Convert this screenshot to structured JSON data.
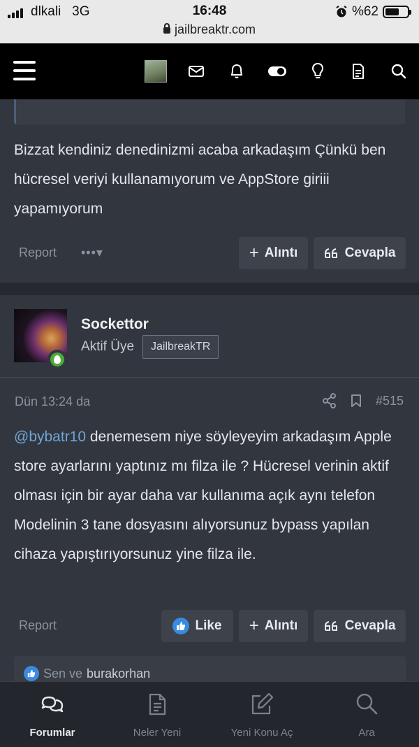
{
  "status_bar": {
    "carrier": "dlkali",
    "network": "3G",
    "time": "16:48",
    "battery_text": "%62",
    "battery_level": 0.62,
    "url": "jailbreaktr.com"
  },
  "topnav": {
    "icons": [
      "menu-icon",
      "site-avatar",
      "envelope-icon",
      "bell-icon",
      "toggle-icon",
      "lightbulb-icon",
      "document-icon",
      "search-icon"
    ]
  },
  "post1": {
    "text": "Bizzat kendiniz denedinizmi acaba arkadaşım Çünkü ben hücresel veriyi kullanamıyorum ve AppStore giriii yapamıyorum",
    "report_label": "Report",
    "more_label": "•••▾",
    "quote_button": "Alıntı",
    "reply_button": "Cevapla"
  },
  "post2": {
    "username": "Sockettor",
    "user_title": "Aktif Üye",
    "user_banner": "JailbreakTR",
    "date": "Dün 13:24 da",
    "post_number": "#515",
    "mention": "@bybatr10",
    "text": " denemesem niye söyleyeyim arkadaşım Apple store ayarlarını yaptınız mı filza ile ? Hücresel verinin aktif olması için bir ayar daha var kullanıma açık aynı telefon Modelinin 3 tane dosyasını alıyorsunuz bypass yapılan cihaza yapıştırıyorsunuz yine filza ile.",
    "report_label": "Report",
    "like_button": "Like",
    "quote_button": "Alıntı",
    "reply_button": "Cevapla",
    "reactions_prefix": "Sen ve",
    "reactions_user": "burakorhan"
  },
  "tabbar": {
    "tabs": [
      {
        "label": "Forumlar",
        "icon": "forums-icon",
        "active": true
      },
      {
        "label": "Neler Yeni",
        "icon": "whats-new-icon",
        "active": false
      },
      {
        "label": "Yeni Konu Aç",
        "icon": "new-thread-icon",
        "active": false
      },
      {
        "label": "Ara",
        "icon": "search-icon",
        "active": false
      }
    ]
  },
  "colors": {
    "background": "#2d3138",
    "nav": "#000000",
    "mention": "#6fa6d8",
    "like_blue": "#3a8be0",
    "online_green": "#4ea83c"
  }
}
